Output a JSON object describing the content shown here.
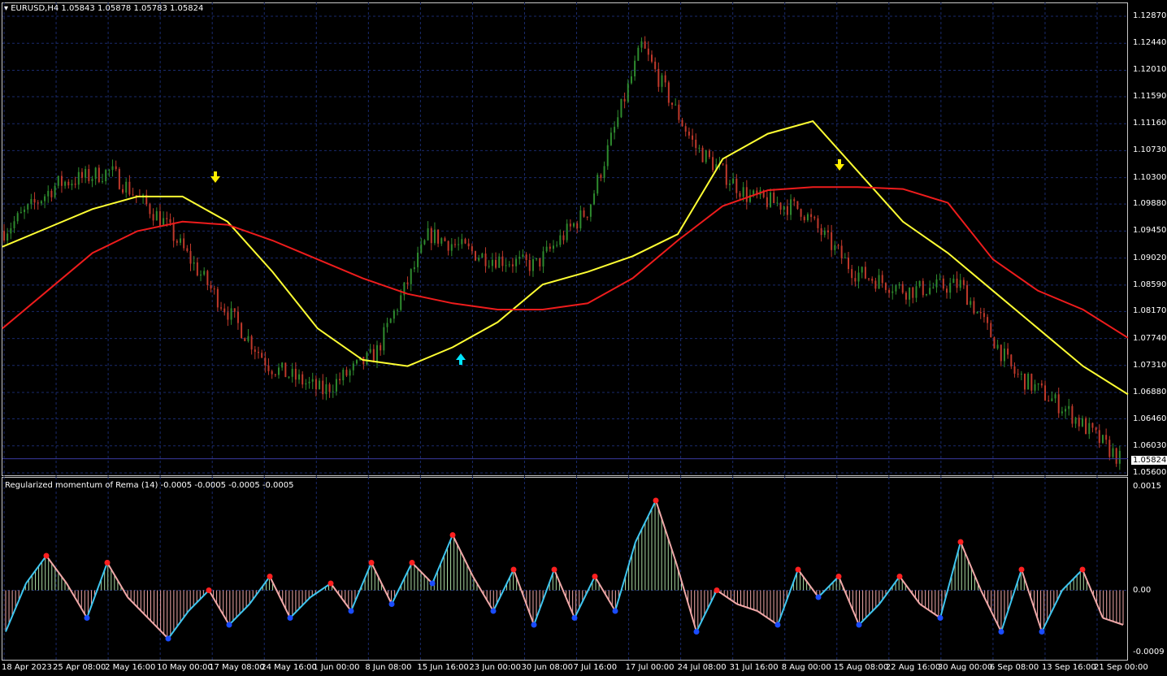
{
  "header": {
    "symbol_line": "EURUSD,H4  1.05843 1.05878 1.05783 1.05824",
    "dropdown_icon": "triangle-down-icon"
  },
  "price_axis": {
    "labels": [
      "1.12870",
      "1.12440",
      "1.12010",
      "1.11590",
      "1.11160",
      "1.10730",
      "1.10300",
      "1.09880",
      "1.09450",
      "1.09020",
      "1.08590",
      "1.08170",
      "1.07740",
      "1.07310",
      "1.06880",
      "1.06460",
      "1.06030",
      "1.05600"
    ],
    "current_price": "1.05824"
  },
  "indicator": {
    "title": "Regularized momentum of Rema (14) -0.0005 -0.0005 -0.0005 -0.0005",
    "axis_labels": [
      "0.0015",
      "0.00",
      "-0.0009"
    ]
  },
  "time_axis": {
    "labels": [
      "18 Apr 2023",
      "25 Apr 08:00",
      "2 May 16:00",
      "10 May 00:00",
      "17 May 08:00",
      "24 May 16:00",
      "1 Jun 00:00",
      "8 Jun 08:00",
      "15 Jun 16:00",
      "23 Jun 00:00",
      "30 Jun 08:00",
      "7 Jul 16:00",
      "17 Jul 00:00",
      "24 Jul 08:00",
      "31 Jul 16:00",
      "8 Aug 00:00",
      "15 Aug 08:00",
      "22 Aug 16:00",
      "30 Aug 00:00",
      "6 Sep 08:00",
      "13 Sep 16:00",
      "21 Sep 00:00"
    ]
  },
  "colors": {
    "background": "#000000",
    "grid": "#1a2a6c",
    "bull_candle": "#2e8b2e",
    "bear_candle": "#c0392b",
    "fast_ma": "#ffff33",
    "slow_ma": "#ee1c1c",
    "signal_down": "#ffee00",
    "signal_up": "#00e5ff",
    "hist_pos": "#a8d8a0",
    "hist_neg": "#f0a8a8",
    "momentum_up": "#3ec6f0",
    "momentum_down": "#f0a8a8",
    "peak_dot": "#ff2020",
    "trough_dot": "#1a4cff"
  },
  "chart_data": {
    "type": "line",
    "symbol": "EURUSD",
    "timeframe": "H4",
    "ylim": [
      1.056,
      1.1287
    ],
    "ohlc_approx": [
      {
        "t": "18 Apr 2023",
        "close": 1.0945
      },
      {
        "t": "25 Apr 08:00",
        "close": 1.102
      },
      {
        "t": "2 May 16:00",
        "close": 1.104
      },
      {
        "t": "10 May 00:00",
        "close": 1.096
      },
      {
        "t": "17 May 08:00",
        "close": 1.084
      },
      {
        "t": "24 May 16:00",
        "close": 1.073
      },
      {
        "t": "1 Jun 00:00",
        "close": 1.069
      },
      {
        "t": "8 Jun 08:00",
        "close": 1.075
      },
      {
        "t": "15 Jun 16:00",
        "close": 1.094
      },
      {
        "t": "23 Jun 00:00",
        "close": 1.0905
      },
      {
        "t": "30 Jun 08:00",
        "close": 1.089
      },
      {
        "t": "7 Jul 16:00",
        "close": 1.098
      },
      {
        "t": "17 Jul 00:00",
        "close": 1.124
      },
      {
        "t": "24 Jul 08:00",
        "close": 1.108
      },
      {
        "t": "31 Jul 16:00",
        "close": 1.1
      },
      {
        "t": "8 Aug 00:00",
        "close": 1.098
      },
      {
        "t": "15 Aug 08:00",
        "close": 1.088
      },
      {
        "t": "22 Aug 16:00",
        "close": 1.085
      },
      {
        "t": "30 Aug 00:00",
        "close": 1.086
      },
      {
        "t": "6 Sep 08:00",
        "close": 1.072
      },
      {
        "t": "13 Sep 16:00",
        "close": 1.066
      },
      {
        "t": "21 Sep 00:00",
        "close": 1.0582
      }
    ],
    "series": [
      {
        "values": [
          1.092,
          1.095,
          1.098,
          1.1,
          1.1,
          1.096,
          1.088,
          1.079,
          1.074,
          1.073,
          1.076,
          1.08,
          1.086,
          1.088,
          1.0905,
          1.094,
          1.106,
          1.11,
          1.112,
          1.104,
          1.096,
          1.091,
          1.085,
          1.079,
          1.073,
          1.0685
        ]
      },
      {
        "values": [
          1.079,
          1.085,
          1.091,
          1.0945,
          1.096,
          1.0955,
          1.093,
          1.09,
          1.087,
          1.0845,
          1.083,
          1.082,
          1.082,
          1.083,
          1.087,
          1.093,
          1.0985,
          1.101,
          1.1015,
          1.1015,
          1.1012,
          1.099,
          1.09,
          1.085,
          1.082,
          1.0775
        ]
      }
    ],
    "signals": [
      {
        "type": "sell",
        "t": "17 May 08:00"
      },
      {
        "type": "buy",
        "t": "23 Jun 00:00"
      },
      {
        "type": "sell",
        "t": "15 Aug 08:00"
      }
    ],
    "momentum": {
      "ylim": [
        -0.0009,
        0.0015
      ],
      "values": [
        -0.0006,
        0.0001,
        0.0005,
        0.0001,
        -0.0004,
        0.0004,
        -0.0001,
        -0.0004,
        -0.0007,
        -0.0003,
        0.0,
        -0.0005,
        -0.0002,
        0.0002,
        -0.0004,
        -0.0001,
        0.0001,
        -0.0003,
        0.0004,
        -0.0002,
        0.0004,
        0.0001,
        0.0008,
        0.0002,
        -0.0003,
        0.0003,
        -0.0005,
        0.0003,
        -0.0004,
        0.0002,
        -0.0003,
        0.0007,
        0.0013,
        0.0004,
        -0.0006,
        0.0,
        -0.0002,
        -0.0003,
        -0.0005,
        0.0003,
        -0.0001,
        0.0002,
        -0.0005,
        -0.0002,
        0.0002,
        -0.0002,
        -0.0004,
        0.0007,
        0.0,
        -0.0006,
        0.0003,
        -0.0006,
        0.0,
        0.0003,
        -0.0004,
        -0.0005
      ]
    }
  }
}
